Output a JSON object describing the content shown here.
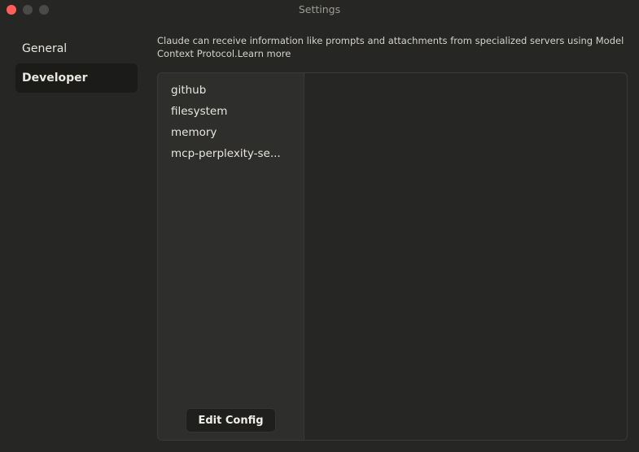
{
  "window": {
    "title": "Settings"
  },
  "sidebar": {
    "items": [
      {
        "label": "General",
        "active": false
      },
      {
        "label": "Developer",
        "active": true
      }
    ]
  },
  "developer": {
    "description": "Claude can receive information like prompts and attachments from specialized servers using Model Context Protocol.",
    "learn_more": "Learn more",
    "servers": [
      "github",
      "filesystem",
      "memory",
      "mcp-perplexity-se..."
    ],
    "edit_config_label": "Edit Config"
  }
}
